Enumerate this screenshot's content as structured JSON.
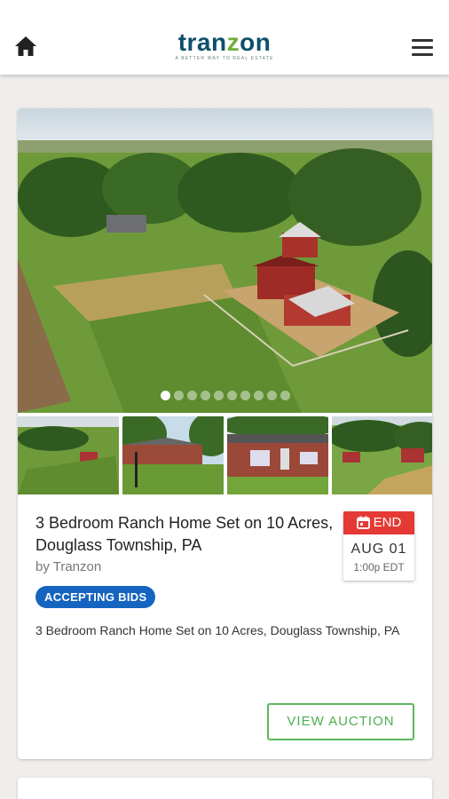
{
  "header": {
    "home_icon": "home-icon",
    "menu_icon": "hamburger-menu-icon",
    "logo": {
      "name_start": "tran",
      "name_z": "z",
      "name_end": "on",
      "tagline": "A BETTER WAY TO REAL ESTATE"
    }
  },
  "listing": {
    "title": "3 Bedroom Ranch Home Set on 10 Acres, Douglass Township, PA",
    "byline": "by Tranzon",
    "status_badge": "ACCEPTING BIDS",
    "status_color": "#1565c0",
    "end": {
      "label": "END",
      "date": "AUG 01",
      "time": "1:00p EDT",
      "icon": "calendar-icon",
      "color": "#e53935"
    },
    "description": "3 Bedroom Ranch Home Set on 10 Acres, Douglass Township, PA",
    "view_button": "VIEW AUCTION",
    "accent_color": "#4caf50",
    "carousel": {
      "total": 10,
      "active": 1
    },
    "thumbnails": [
      "aerial-farm-photo",
      "house-side-photo",
      "house-front-photo",
      "barn-field-photo"
    ]
  }
}
